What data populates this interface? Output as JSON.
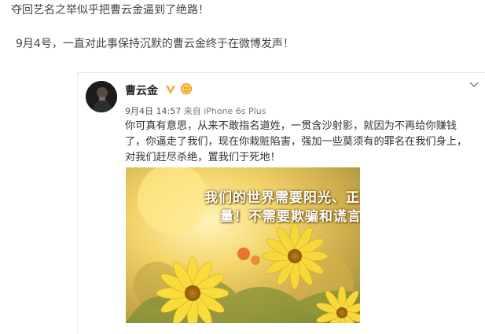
{
  "article": {
    "line1": "夺回艺名之举似乎把曹云金逼到了绝路！",
    "line2": "9月4号，一直对此事保持沉默的曹云金终于在微博发声！"
  },
  "post": {
    "author": "曹云金",
    "date": "9月4日",
    "time": "14:57",
    "source": "来自 iPhone 6s Plus",
    "text": "你可真有意思，从来不敢指名道姓，一贯含沙射影，就因为不再给你赚钱了，你逼走了我们，现在你栽赃陷害，强加一些莫须有的罪名在我们身上，对我们赶尽杀绝，置我们于死地！",
    "image_text_line1": "我们的世界需要阳光、正能",
    "image_text_line2": "量！不需要欺骗和谎言！"
  },
  "colors": {
    "verified": "#f5a623",
    "text": "#333333",
    "meta": "#777777"
  },
  "icons": {
    "verified": "verified-v-icon",
    "badge": "member-badge-icon",
    "menu": "chevron-down-icon"
  }
}
